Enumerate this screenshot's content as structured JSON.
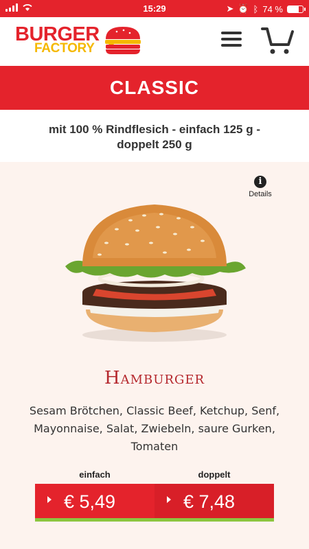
{
  "status_bar": {
    "time": "15:29",
    "battery_text": "74 %",
    "battery_level": 0.74
  },
  "brand": {
    "word1": "BURGER",
    "word2": "FACTORY"
  },
  "header": {
    "menu_icon": "hamburger-menu-icon",
    "cart_icon": "shopping-cart-icon"
  },
  "category": {
    "title": "CLASSIC",
    "subtitle": "mit 100 % Rindflesich - einfach 125 g - doppelt 250 g"
  },
  "details": {
    "icon": "info-icon",
    "label": "Details"
  },
  "product": {
    "name": "Hamburger",
    "ingredients": "Sesam Brötchen, Classic Beef, Ketchup, Senf, Mayonnaise, Salat, Zwiebeln, saure Gurken, Tomaten"
  },
  "prices": [
    {
      "label": "einfach",
      "price": "€ 5,49"
    },
    {
      "label": "doppelt",
      "price": "€ 7,48"
    }
  ],
  "colors": {
    "brand_red": "#e4232c",
    "brand_yellow": "#f5b800",
    "accent_green": "#8cc63f",
    "background": "#fdf3ee"
  }
}
